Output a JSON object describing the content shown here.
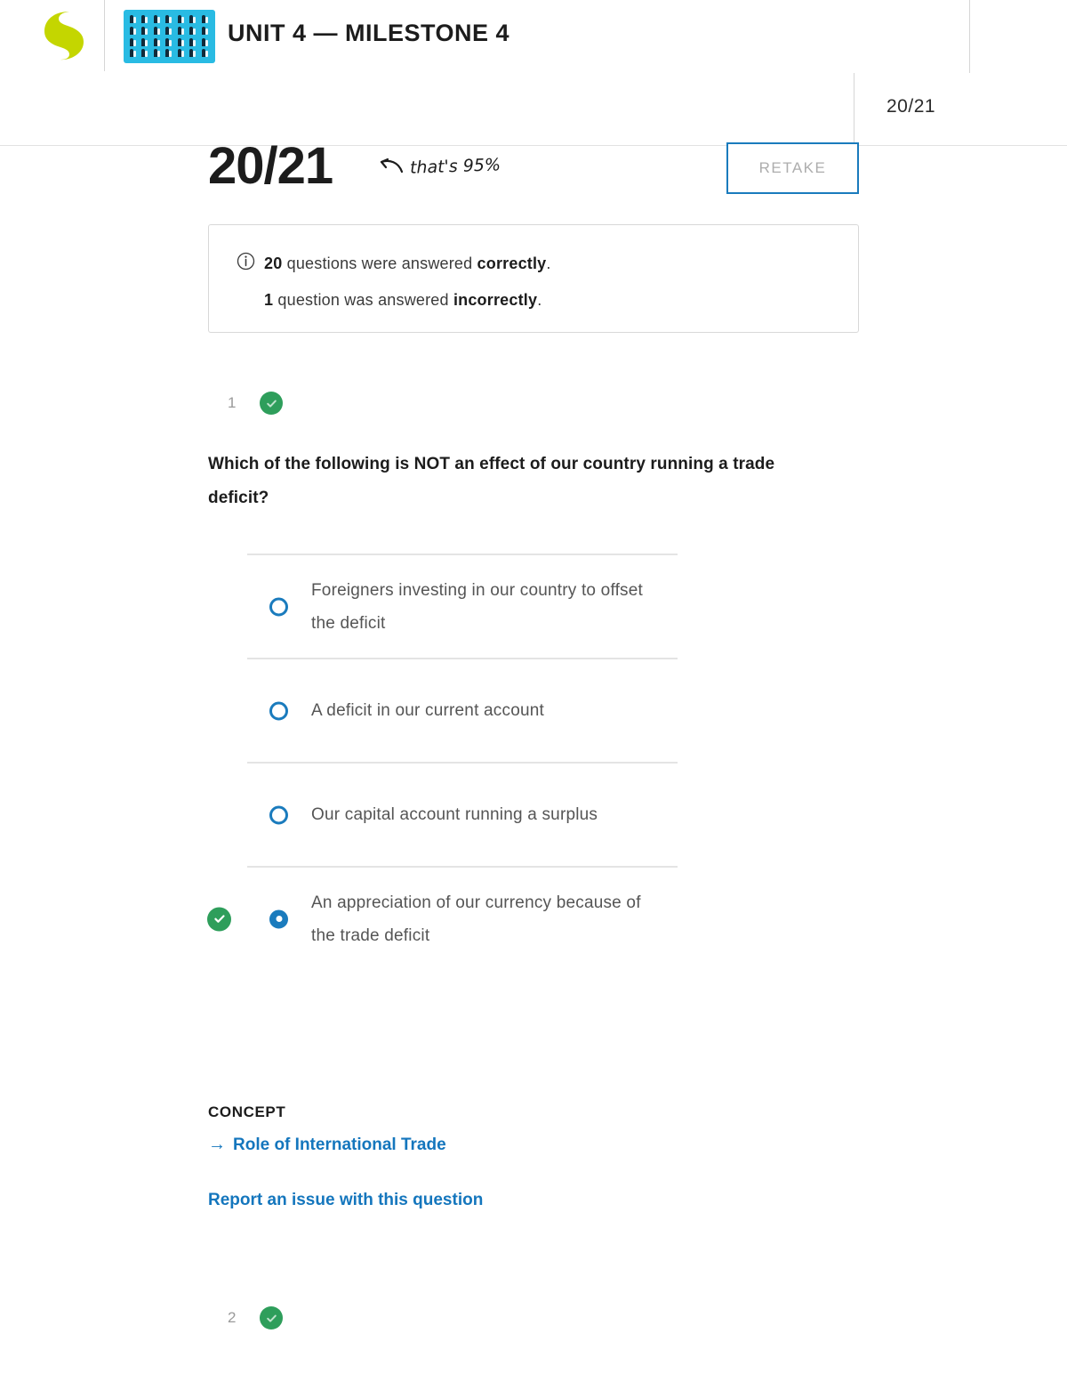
{
  "header": {
    "logo_name": "sophia-s-logo",
    "unit_icon_name": "people-grid-icon",
    "title": "UNIT 4 — MILESTONE 4",
    "score_chip": "20/21"
  },
  "score": {
    "value": "20/21",
    "annotation": "that's 95%",
    "annotation_arrow": "curved-left-arrow",
    "retake_label": "RETAKE"
  },
  "summary": {
    "icon": "info-icon",
    "line1_count": "20",
    "line1_mid": " questions were answered ",
    "line1_emph": "correctly",
    "line1_end": ".",
    "line2_count": "1",
    "line2_mid": " question was answered ",
    "line2_emph": "incorrectly",
    "line2_end": "."
  },
  "question": {
    "number": "1",
    "status_icon": "check-circle-icon",
    "text": "Which of the following is NOT an effect of our country running a trade deficit?",
    "options": [
      {
        "text": "Foreigners investing in our country to offset the deficit",
        "selected": false,
        "correct": false
      },
      {
        "text": "A deficit in our current account",
        "selected": false,
        "correct": false
      },
      {
        "text": "Our capital account running a surplus",
        "selected": false,
        "correct": false
      },
      {
        "text": "An appreciation of our currency because of the trade deficit",
        "selected": true,
        "correct": true
      }
    ]
  },
  "footer": {
    "concept_label": "CONCEPT",
    "concept_arrow": "→",
    "concept_link": "Role of International Trade",
    "report_link": "Report an issue with this question"
  },
  "next_question": {
    "number": "2",
    "status_icon": "check-circle-icon"
  },
  "colors": {
    "brand_green": "#c4d600",
    "icon_cyan": "#29bbe3",
    "accent_blue": "#1a7bbd",
    "link_blue": "#1476bd",
    "success_green": "#2e9e5b",
    "muted_gray": "#9a9a9a"
  }
}
